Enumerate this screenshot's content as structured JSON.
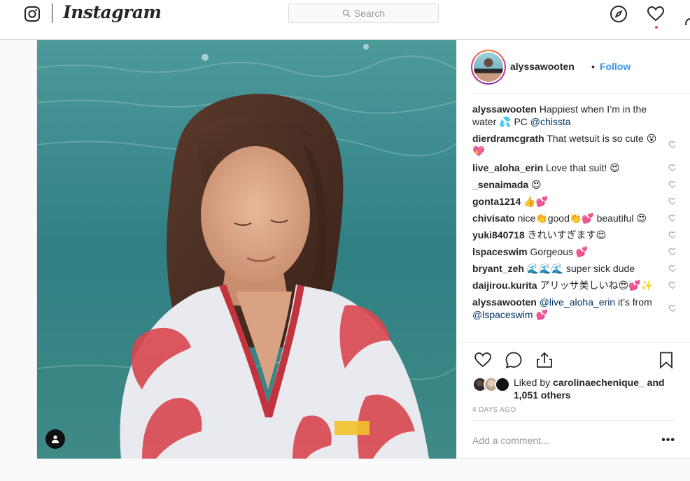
{
  "nav": {
    "search_placeholder": "Search"
  },
  "post": {
    "author": "alyssawooten",
    "dot": "•",
    "follow_label": "Follow",
    "comments": [
      {
        "user": "alyssawooten",
        "parts": [
          {
            "t": " Happiest when I’m in the water 💦 PC "
          },
          {
            "m": "@chissta"
          }
        ],
        "heart": false
      },
      {
        "user": "dierdramcgrath",
        "parts": [
          {
            "t": " That wetsuit is so cute 😮💖"
          }
        ],
        "heart": true
      },
      {
        "user": "live_aloha_erin",
        "parts": [
          {
            "t": " Love that suit! 😍"
          }
        ],
        "heart": true
      },
      {
        "user": "_senaimada",
        "parts": [
          {
            "t": " 😍"
          }
        ],
        "heart": true
      },
      {
        "user": "gonta1214",
        "parts": [
          {
            "t": " 👍💕"
          }
        ],
        "heart": true
      },
      {
        "user": "chivisato",
        "parts": [
          {
            "t": " nice👏good👏💕 beautiful 😍"
          }
        ],
        "heart": true
      },
      {
        "user": "yuki840718",
        "parts": [
          {
            "t": " きれいすぎます😍"
          }
        ],
        "heart": true
      },
      {
        "user": "lspaceswim",
        "parts": [
          {
            "t": " Gorgeous 💕"
          }
        ],
        "heart": true
      },
      {
        "user": "bryant_zeh",
        "parts": [
          {
            "t": " 🌊🌊🌊 super sick dude"
          }
        ],
        "heart": true
      },
      {
        "user": "daijirou.kurita",
        "parts": [
          {
            "t": " アリッサ美しいね😍💕✨"
          }
        ],
        "heart": true
      },
      {
        "user": "alyssawooten",
        "parts": [
          {
            "t": " "
          },
          {
            "m": "@live_aloha_erin"
          },
          {
            "t": " it’s from "
          },
          {
            "m": "@lspaceswim"
          },
          {
            "t": " 💕"
          }
        ],
        "heart": true
      }
    ],
    "liked_by_prefix": "Liked by ",
    "liked_by_user": "carolinaechenique_",
    "liked_by_suffix": " and 1,051 others",
    "timestamp": "4 DAYS AGO",
    "add_comment_placeholder": "Add a comment...",
    "more_label": "•••"
  },
  "colors": {
    "link": "#3897f0",
    "mention": "#003569",
    "notification": "#ed4956"
  }
}
